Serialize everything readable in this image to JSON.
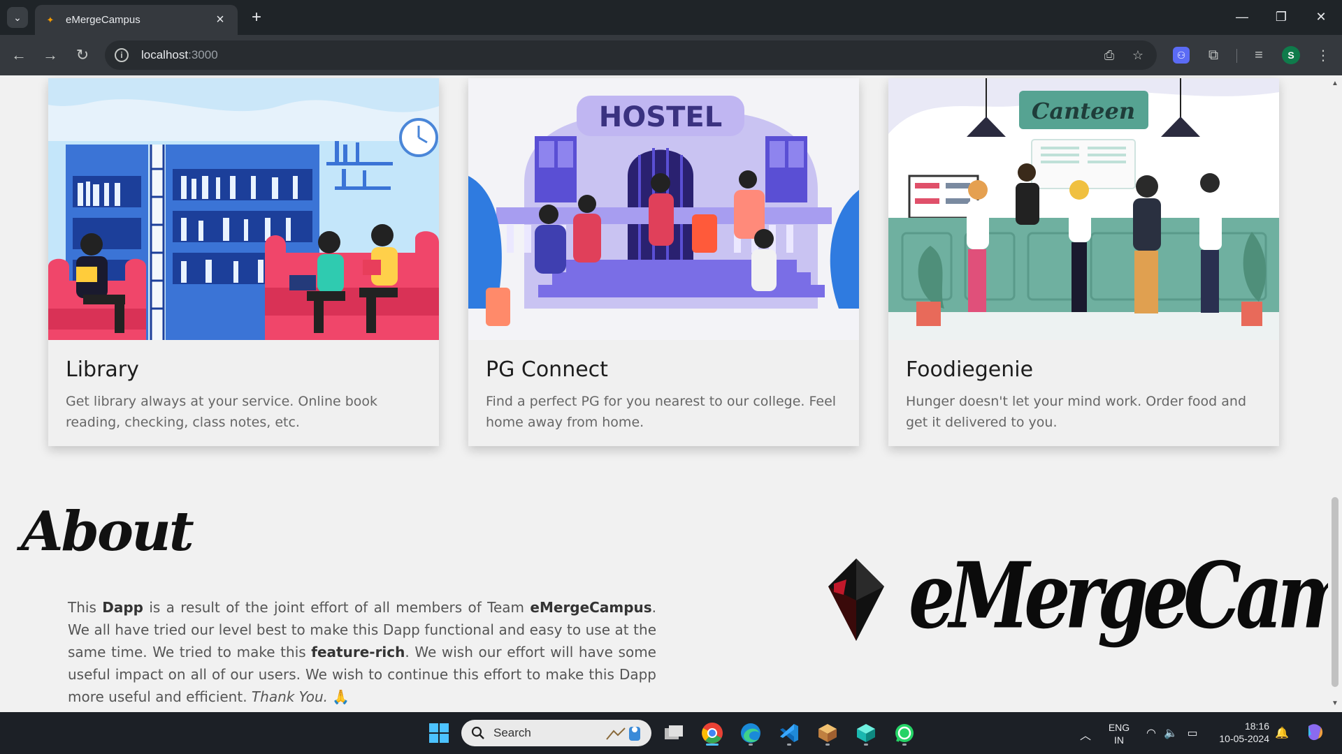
{
  "browser": {
    "tab_title": "eMergeCampus",
    "url_host": "localhost",
    "url_port": ":3000",
    "profile_initial": "S"
  },
  "cards": [
    {
      "title": "Library",
      "description": "Get library always at your service. Online book reading, checking, class notes, etc.",
      "image_label": ""
    },
    {
      "title": "PG Connect",
      "description": "Find a perfect PG for you nearest to our college. Feel home away from home.",
      "image_label": "HOSTEL"
    },
    {
      "title": "Foodiegenie",
      "description": "Hunger doesn't let your mind work. Order food and get it delivered to you.",
      "image_label": "Canteen"
    }
  ],
  "about": {
    "heading": "About",
    "p1": "This ",
    "b1": "Dapp",
    "p2": " is a result of the joint effort of all members of Team ",
    "b2": "eMergeCampus",
    "p3": ". We all have tried our level best to make this Dapp functional and easy to use at the same time. We tried to make this ",
    "b3": "feature-rich",
    "p4": ". We wish our effort will have some useful impact on all of our users. We wish to continue this effort to make this Dapp more useful and efficient. ",
    "i1": "Thank You.",
    "emoji": "🙏"
  },
  "brand": {
    "name": "eMergeCampus"
  },
  "taskbar": {
    "search_label": "Search",
    "lang_line1": "ENG",
    "lang_line2": "IN",
    "time": "18:16",
    "date": "10-05-2024"
  },
  "colors": {
    "page_bg": "#f1f1f1",
    "card_bg": "#f0f0f0",
    "browser_dark": "#1f2428",
    "toolbar": "#35393e",
    "accent_blue": "#4cc2ff"
  }
}
